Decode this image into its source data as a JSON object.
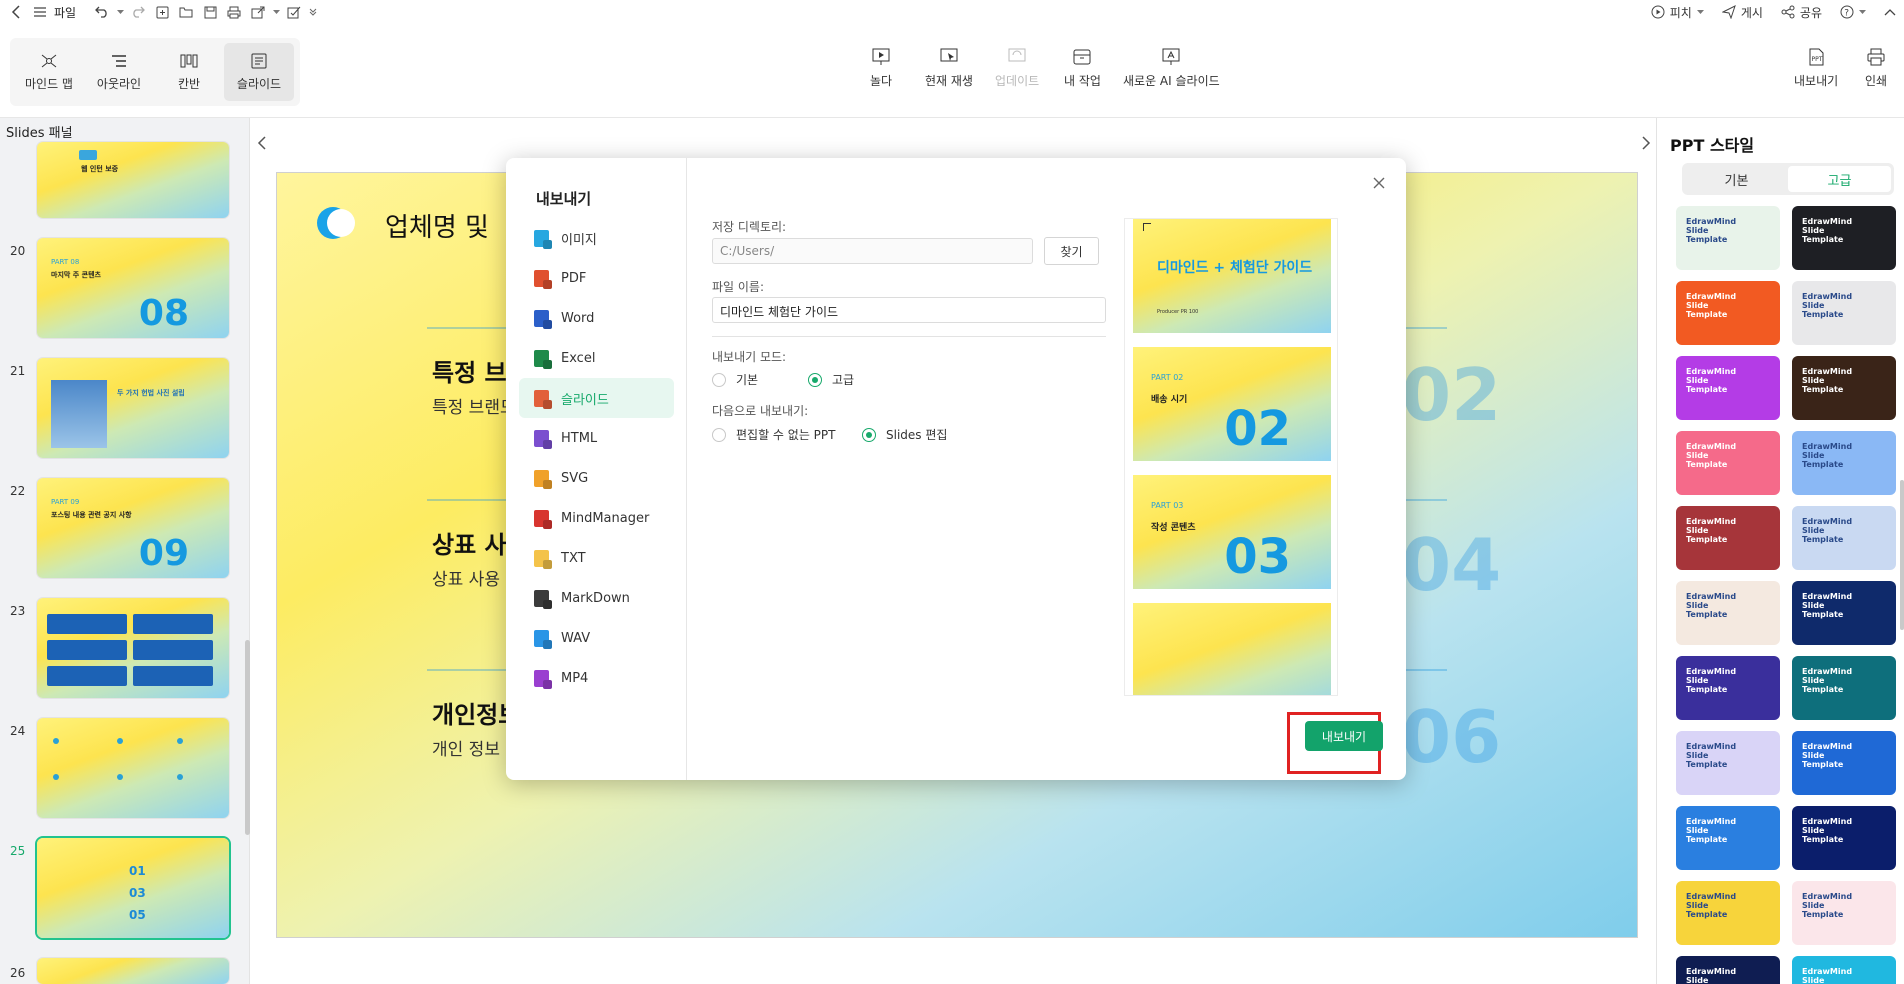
{
  "menubar": {
    "file_label": "파일",
    "present_label": "피치",
    "post_label": "게시",
    "share_label": "공유"
  },
  "view_tabs": [
    {
      "label": "마인드 맵",
      "icon": "mindmap-icon"
    },
    {
      "label": "아웃라인",
      "icon": "outline-icon"
    },
    {
      "label": "칸반",
      "icon": "kanban-icon"
    },
    {
      "label": "슬라이드",
      "icon": "slide-icon",
      "active": true
    }
  ],
  "ribbon": {
    "play_from_start": "놀다",
    "play_current": "현재 재생",
    "update": "업데이트",
    "my_work": "내 작업",
    "new_ai_slide": "새로운 AI 슬라이드",
    "export": "내보내기",
    "print": "인쇄"
  },
  "left_panel": {
    "title": "Slides 패널",
    "slides": [
      {
        "num": "",
        "part": "",
        "title": "웹 인턴 보증",
        "big": ""
      },
      {
        "num": "20",
        "part": "PART 08",
        "title": "마지막 주 콘텐츠",
        "big": "08"
      },
      {
        "num": "21",
        "part": "",
        "title": "두 가지 헌법 사진 설립",
        "big": ""
      },
      {
        "num": "22",
        "part": "PART 09",
        "title": "포스팅 내용 관련 공지 사항",
        "big": "09"
      },
      {
        "num": "23",
        "part": "",
        "title": "",
        "big": ""
      },
      {
        "num": "24",
        "part": "",
        "title": "",
        "big": ""
      },
      {
        "num": "25",
        "part": "",
        "title": "",
        "big": "",
        "selected": true
      },
      {
        "num": "26",
        "part": "",
        "title": "",
        "big": ""
      }
    ]
  },
  "slide": {
    "title": "업체명 및",
    "items": [
      {
        "heading": "특정 브랜",
        "sub": "특정 브랜드",
        "num": "02"
      },
      {
        "heading": "상표 사",
        "sub": "상표 사용",
        "num": "04"
      },
      {
        "heading": "개인정보",
        "sub": "개인 정보",
        "num": "06"
      }
    ]
  },
  "right_panel": {
    "title": "PPT 스타일",
    "tab_basic": "기본",
    "tab_advanced": "고급",
    "templates": [
      {
        "text": "EdrawMind Slide Template",
        "bg": "#e8f3ea"
      },
      {
        "text": "EdrawMind Slide Template",
        "bg": "#1e1f24"
      },
      {
        "text": "EdrawMind Slide Template",
        "bg": "#f25a22"
      },
      {
        "text": "EdrawMind Slide Template",
        "bg": "#e8e8ea"
      },
      {
        "text": "EdrawMind Slide Template",
        "bg": "#b43ce6"
      },
      {
        "text": "EdrawMind Slide Template",
        "bg": "#3a2418"
      },
      {
        "text": "EdrawMind Slide Template",
        "bg": "#f56a8a"
      },
      {
        "text": "EdrawMind Slide Template",
        "bg": "#8ab8f5"
      },
      {
        "text": "EdrawMind Slide Template",
        "bg": "#a6353a"
      },
      {
        "text": "EdrawMind Slide Template",
        "bg": "#c9d9f2"
      },
      {
        "text": "EdrawMind Slide Template",
        "bg": "#f4e9e0"
      },
      {
        "text": "EdrawMind Slide Template",
        "bg": "#0f2a6b"
      },
      {
        "text": "EdrawMind Slide Template",
        "bg": "#3a2f9c"
      },
      {
        "text": "EdrawMind Slide Template",
        "bg": "#0e6f7c"
      },
      {
        "text": "EdrawMind Slide Template",
        "bg": "#d9d4f7"
      },
      {
        "text": "EdrawMind Slide Template",
        "bg": "#1f69d6"
      },
      {
        "text": "EdrawMind Slide Template",
        "bg": "#2a7fe0"
      },
      {
        "text": "EdrawMind Slide Template",
        "bg": "#0b1e6b"
      },
      {
        "text": "EdrawMind Slide Template",
        "bg": "#f7d43b"
      },
      {
        "text": "EdrawMind Slide Template",
        "bg": "#fbe6ea"
      },
      {
        "text": "EdrawMind Slide Template",
        "bg": "#0f1d52"
      },
      {
        "text": "EdrawMind Slide Template",
        "bg": "#20b8e0"
      }
    ]
  },
  "dialog": {
    "title": "내보내기",
    "formats": [
      {
        "label": "이미지",
        "color": "#27a7e0"
      },
      {
        "label": "PDF",
        "color": "#e0502f"
      },
      {
        "label": "Word",
        "color": "#2b5fc9"
      },
      {
        "label": "Excel",
        "color": "#1f8a4a"
      },
      {
        "label": "슬라이드",
        "color": "#e2603a",
        "active": true
      },
      {
        "label": "HTML",
        "color": "#7b4fcf"
      },
      {
        "label": "SVG",
        "color": "#f0a12a"
      },
      {
        "label": "MindManager",
        "color": "#d8352f"
      },
      {
        "label": "TXT",
        "color": "#f4c34a"
      },
      {
        "label": "MarkDown",
        "color": "#3b3b3b"
      },
      {
        "label": "WAV",
        "color": "#2a95e6"
      },
      {
        "label": "MP4",
        "color": "#9a3fd0"
      }
    ],
    "dir_label": "저장 디렉토리:",
    "dir_value": "C:/Users/",
    "find_button": "찾기",
    "filename_label": "파일 이름:",
    "filename_value": "디마인드 체험단 가이드",
    "mode_label": "내보내기 모드:",
    "mode_basic": "기본",
    "mode_advanced": "고급",
    "as_label": "다음으로 내보내기:",
    "as_ppt": "편집할 수 없는 PPT",
    "as_slides": "Slides 편집",
    "export_button": "내보내기",
    "preview": [
      {
        "part": "",
        "title": "디마인드 + 체험단 가이드",
        "sub": "Producer PR 100",
        "big": ""
      },
      {
        "part": "PART 02",
        "title": "배송 시기",
        "sub": "",
        "big": "02"
      },
      {
        "part": "PART 03",
        "title": "작성 콘텐츠",
        "sub": "",
        "big": "03"
      }
    ]
  }
}
